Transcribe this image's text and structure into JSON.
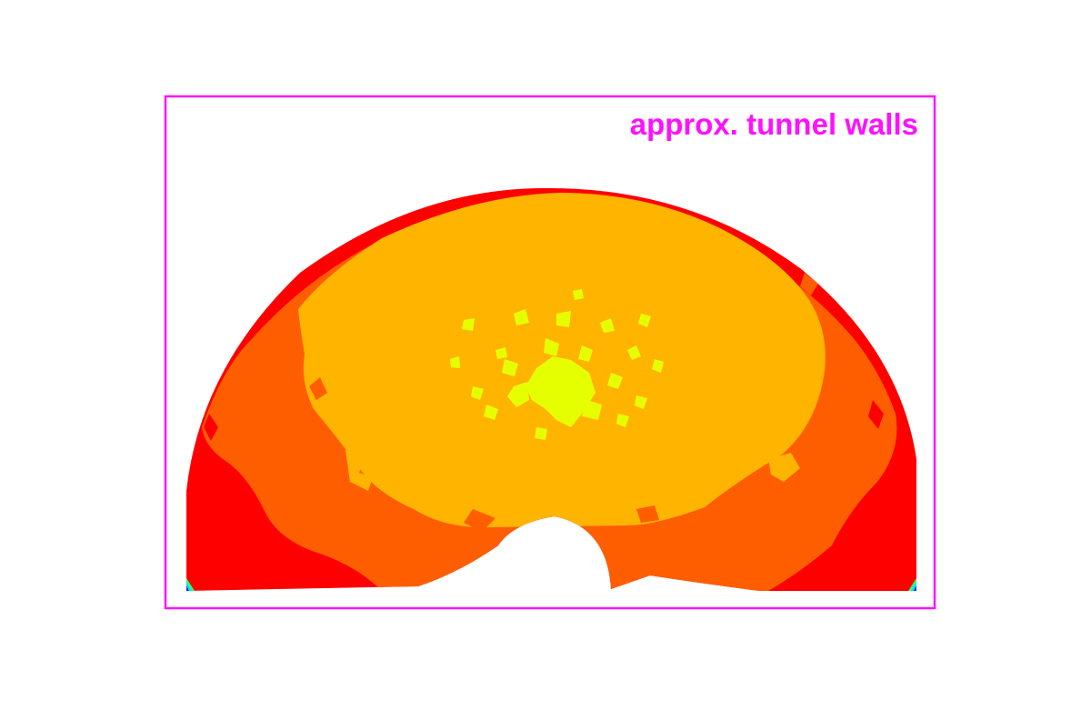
{
  "annotation": {
    "label": "approx. tunnel walls",
    "color": "#ff10ff"
  },
  "colors": {
    "background": "#ffffff",
    "band_outer": "#ff0000",
    "band_mid": "#ff5e00",
    "band_inner": "#ffb400",
    "core": "#e6ff00",
    "corner_blue": "#0033ff",
    "corner_cyan": "#00e5ff",
    "corner_green": "#33ff66"
  }
}
